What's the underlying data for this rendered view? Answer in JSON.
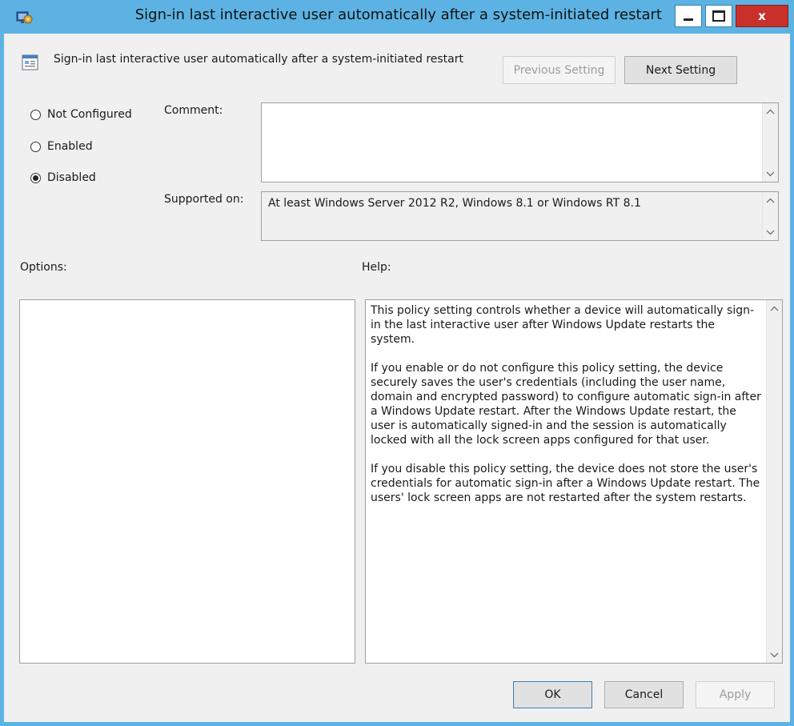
{
  "window": {
    "title": "Sign-in last interactive user automatically after a system-initiated restart",
    "minimize_glyph": "minimize-icon",
    "maximize_glyph": "maximize-icon",
    "close_glyph": "x"
  },
  "header": {
    "policy_name": "Sign-in last interactive user automatically after a system-initiated restart",
    "previous_label": "Previous Setting",
    "next_label": "Next Setting"
  },
  "state": {
    "options": [
      {
        "label": "Not Configured",
        "checked": false
      },
      {
        "label": "Enabled",
        "checked": false
      },
      {
        "label": "Disabled",
        "checked": true
      }
    ]
  },
  "comment": {
    "label": "Comment:",
    "value": ""
  },
  "supported": {
    "label": "Supported on:",
    "value": "At least Windows Server 2012 R2, Windows 8.1 or Windows RT 8.1"
  },
  "options_pane": {
    "label": "Options:"
  },
  "help_pane": {
    "label": "Help:",
    "paragraphs": [
      "This policy setting controls whether a device will automatically sign-in the last interactive user after Windows Update restarts the system.",
      "If you enable or do not configure this policy setting, the device securely saves the user's credentials (including the user name, domain and encrypted password) to configure automatic sign-in after a Windows Update restart. After the Windows Update restart, the user is automatically signed-in and the session is automatically locked with all the lock screen apps configured for that user.",
      "If you disable this policy setting, the device does not store the user's credentials for automatic sign-in after a Windows Update restart. The users' lock screen apps are not restarted after the system restarts."
    ]
  },
  "footer": {
    "ok_label": "OK",
    "cancel_label": "Cancel",
    "apply_label": "Apply"
  },
  "colors": {
    "titlebar": "#5cb3e3",
    "close_button": "#c7312a",
    "dialog_bg": "#f0f0f0"
  }
}
